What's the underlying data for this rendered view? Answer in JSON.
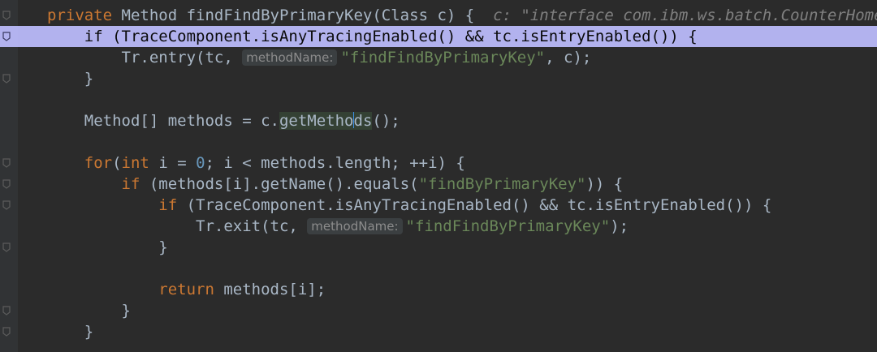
{
  "editor": {
    "lines": [
      {
        "id": "l1",
        "parts": [
          {
            "t": "private",
            "c": "kw"
          },
          {
            "t": " Method findFindByPrimaryKey(Class c) {  "
          },
          {
            "t": "c: \"interface com.ibm.ws.batch.CounterHome\"",
            "c": "inline-comment"
          }
        ]
      },
      {
        "id": "l2",
        "parts": [
          {
            "t": "    if (TraceComponent.isAnyTracingEnabled() && tc.isEntryEnabled()) {"
          }
        ]
      },
      {
        "id": "l3",
        "parts": [
          {
            "t": "        Tr.entry(tc, "
          },
          {
            "t": "methodName:",
            "c": "hint"
          },
          {
            "t": "\"findFindByPrimaryKey\"",
            "c": "str"
          },
          {
            "t": ", c);"
          }
        ]
      },
      {
        "id": "l4",
        "parts": [
          {
            "t": "    }"
          }
        ]
      },
      {
        "id": "l5",
        "parts": [
          {
            "t": ""
          }
        ]
      },
      {
        "id": "l6",
        "parts": [
          {
            "t": "    Method[] methods = c."
          },
          {
            "t": "getMetho",
            "c": "word-hl"
          },
          {
            "t": "",
            "c": "caret"
          },
          {
            "t": "ds",
            "c": "word-hl"
          },
          {
            "t": "();"
          }
        ]
      },
      {
        "id": "l7",
        "parts": [
          {
            "t": ""
          }
        ]
      },
      {
        "id": "l8",
        "parts": [
          {
            "t": "    "
          },
          {
            "t": "for",
            "c": "kw"
          },
          {
            "t": "("
          },
          {
            "t": "int",
            "c": "kw"
          },
          {
            "t": " i = "
          },
          {
            "t": "0",
            "c": "num"
          },
          {
            "t": "; i < methods.length; ++i) {"
          }
        ]
      },
      {
        "id": "l9",
        "parts": [
          {
            "t": "        "
          },
          {
            "t": "if",
            "c": "kw"
          },
          {
            "t": " (methods[i].getName().equals("
          },
          {
            "t": "\"findByPrimaryKey\"",
            "c": "str"
          },
          {
            "t": ")) {"
          }
        ]
      },
      {
        "id": "l10",
        "parts": [
          {
            "t": "            "
          },
          {
            "t": "if",
            "c": "kw"
          },
          {
            "t": " (TraceComponent.isAnyTracingEnabled() && tc.isEntryEnabled()) {"
          }
        ]
      },
      {
        "id": "l11",
        "parts": [
          {
            "t": "                Tr.exit(tc, "
          },
          {
            "t": "methodName:",
            "c": "hint"
          },
          {
            "t": "\"findFindByPrimaryKey\"",
            "c": "str"
          },
          {
            "t": ");"
          }
        ]
      },
      {
        "id": "l12",
        "parts": [
          {
            "t": "            }"
          }
        ]
      },
      {
        "id": "l13",
        "parts": [
          {
            "t": ""
          }
        ]
      },
      {
        "id": "l14",
        "parts": [
          {
            "t": "            "
          },
          {
            "t": "return",
            "c": "kw"
          },
          {
            "t": " methods[i];"
          }
        ]
      },
      {
        "id": "l15",
        "parts": [
          {
            "t": "        }"
          }
        ]
      },
      {
        "id": "l16",
        "parts": [
          {
            "t": "    }"
          }
        ]
      }
    ],
    "selected_line": "l2",
    "colors": {
      "background": "#2b2b2b",
      "keyword": "#cc7832",
      "string": "#6a8759",
      "number": "#6897bb",
      "selection": "#c8c8f6"
    },
    "fold_icons": [
      "l1",
      "l2",
      "l4",
      "l8",
      "l9",
      "l10",
      "l12",
      "l15",
      "l16"
    ]
  }
}
